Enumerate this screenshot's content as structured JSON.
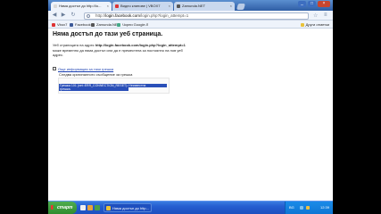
{
  "colors": {
    "tabstrip": "#3f70b0",
    "link": "#1a3fb0",
    "selection": "#2a4fb8",
    "taskbar": "#245dd0",
    "start": "#3a9a3a"
  },
  "tabs": [
    {
      "title": "Няма достъп до http://lo...",
      "icon": "page-icon",
      "active": true
    },
    {
      "title": "Видео клипове | VBOX7",
      "icon": "vbox7-icon",
      "active": false
    },
    {
      "title": "Zamunda.NET",
      "icon": "zamunda-icon",
      "active": false
    }
  ],
  "window_controls": {
    "minimize": "_",
    "maximize": "□",
    "close": "×"
  },
  "toolbar": {
    "back": "◀",
    "forward": "▶",
    "reload": "↻",
    "url_prefix": "http://",
    "url_host": "login.facebook.com",
    "url_path": "/login.php?login_attempt=1",
    "star": "☆",
    "wrench": "🔧"
  },
  "bookmarks": {
    "items": [
      {
        "label": "Vbox7",
        "color": "#d33"
      },
      {
        "label": "Facebook",
        "color": "#3b5998"
      },
      {
        "label": "Zamunda.NET",
        "color": "#555"
      },
      {
        "label": "Чорни Google.Л",
        "color": "#4a8"
      }
    ],
    "other": "Други отметки"
  },
  "error_page": {
    "title": "Няма достъп до тази уеб страница.",
    "body_pre": "Уеб страницата на адрес ",
    "body_url": "http://login.facebook.com/login.php?login_attempt=1",
    "body_post": " може временно да няма достъп или да е преместена за постоянно на нов уеб адрес.",
    "more_info": "Още информация за тази грешка",
    "details_label": "Следва оригиналното съобщение за грешка",
    "error_line1": "Грешка 101 (net::ERR_CONNECTION_RESET): Неизвестна",
    "error_line2": "грешка."
  },
  "taskbar": {
    "start": "старт",
    "task_title": "Няма достъп до http...",
    "tray_lang": "BG",
    "clock": "12:39"
  }
}
